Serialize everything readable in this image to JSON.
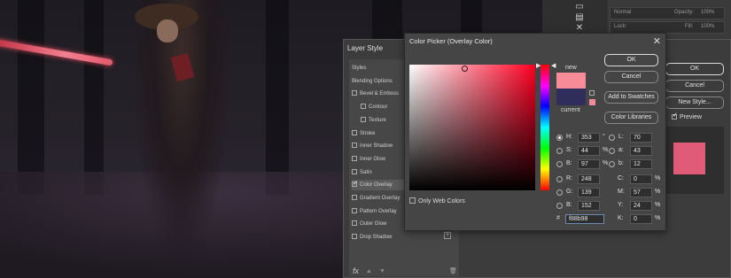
{
  "layer_style": {
    "title": "Layer Style",
    "list": [
      {
        "label": "Styles",
        "checkbox": false,
        "checked": false,
        "sub": false
      },
      {
        "label": "Blending Options",
        "checkbox": false,
        "checked": false,
        "sub": false
      },
      {
        "label": "Bevel & Emboss",
        "checkbox": true,
        "checked": false,
        "sub": false
      },
      {
        "label": "Contour",
        "checkbox": true,
        "checked": false,
        "sub": true
      },
      {
        "label": "Texture",
        "checkbox": true,
        "checked": false,
        "sub": true
      },
      {
        "label": "Stroke",
        "checkbox": true,
        "checked": false,
        "sub": false
      },
      {
        "label": "Inner Shadow",
        "checkbox": true,
        "checked": false,
        "sub": false
      },
      {
        "label": "Inner Glow",
        "checkbox": true,
        "checked": false,
        "sub": false
      },
      {
        "label": "Satin",
        "checkbox": true,
        "checked": false,
        "sub": false
      },
      {
        "label": "Color Overlay",
        "checkbox": true,
        "checked": true,
        "sub": false
      },
      {
        "label": "Gradient Overlay",
        "checkbox": true,
        "checked": false,
        "sub": false
      },
      {
        "label": "Pattern Overlay",
        "checkbox": true,
        "checked": false,
        "sub": false
      },
      {
        "label": "Outer Glow",
        "checkbox": true,
        "checked": false,
        "sub": false
      },
      {
        "label": "Drop Shadow",
        "checkbox": true,
        "checked": false,
        "sub": false
      }
    ],
    "fx_label": "fx",
    "ok": "OK",
    "cancel": "Cancel",
    "new_style": "New Style...",
    "preview": "Preview",
    "preview_color": "#e05b77"
  },
  "color_picker": {
    "title": "Color Picker (Overlay Color)",
    "new_label": "new",
    "current_label": "current",
    "new_color": "#f88b98",
    "current_color": "#302c5c",
    "field_hue_color": "#ff0022",
    "ok": "OK",
    "cancel": "Cancel",
    "add_to_swatches": "Add to Swatches",
    "color_libraries": "Color Libraries",
    "only_web_colors": "Only Web Colors",
    "hsb": [
      {
        "label": "H:",
        "value": "353",
        "unit": "°",
        "selected": true
      },
      {
        "label": "S:",
        "value": "44",
        "unit": "%",
        "selected": false
      },
      {
        "label": "B:",
        "value": "97",
        "unit": "%",
        "selected": false
      }
    ],
    "rgb": [
      {
        "label": "R:",
        "value": "248"
      },
      {
        "label": "G:",
        "value": "139"
      },
      {
        "label": "B:",
        "value": "152"
      }
    ],
    "lab": [
      {
        "label": "L:",
        "value": "70"
      },
      {
        "label": "a:",
        "value": "43"
      },
      {
        "label": "b:",
        "value": "12"
      }
    ],
    "cmyk": [
      {
        "label": "C:",
        "value": "0",
        "unit": "%"
      },
      {
        "label": "M:",
        "value": "57",
        "unit": "%"
      },
      {
        "label": "Y:",
        "value": "24",
        "unit": "%"
      },
      {
        "label": "K:",
        "value": "0",
        "unit": "%"
      }
    ],
    "hex_label": "#",
    "hex_value": "f88b98"
  },
  "ps_panel": {
    "normal": "Normal",
    "opacity": "Opacity:",
    "opacity_value": "100%",
    "lock": "Lock:",
    "fill": "Fill:",
    "fill_value": "100%"
  }
}
